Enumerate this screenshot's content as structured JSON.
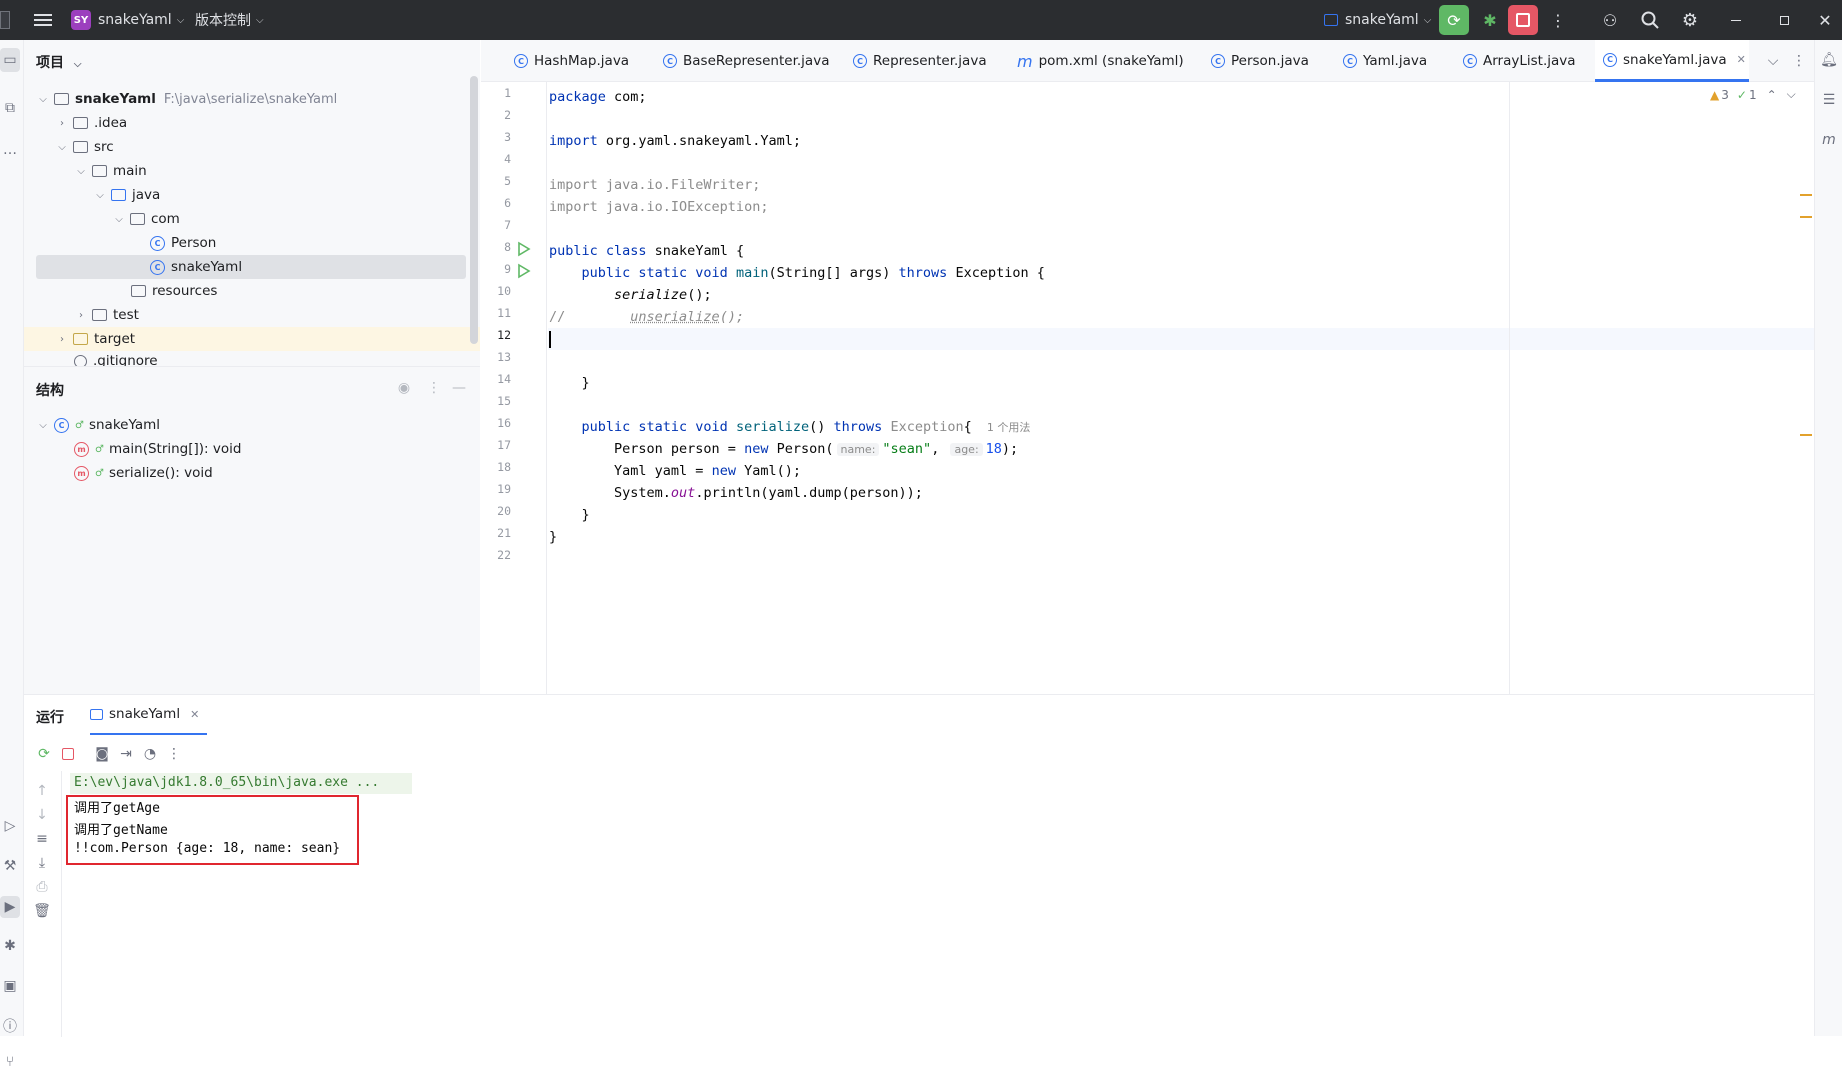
{
  "titlebar": {
    "project_badge": "SY",
    "project_name": "snakeYaml",
    "vcs_menu": "版本控制",
    "run_config": "snakeYaml",
    "colors": {
      "bg": "#2b2d30",
      "run_green": "#5fb865",
      "stop_red": "#e55765"
    }
  },
  "project_panel": {
    "title": "项目",
    "root_name": "snakeYaml",
    "root_path": "F:\\java\\serialize\\snakeYaml",
    "items": [
      {
        "label": ".idea"
      },
      {
        "label": "src"
      },
      {
        "label": "main"
      },
      {
        "label": "java"
      },
      {
        "label": "com"
      },
      {
        "label": "Person"
      },
      {
        "label": "snakeYaml"
      },
      {
        "label": "resources"
      },
      {
        "label": "test"
      },
      {
        "label": "target"
      },
      {
        "label": ".gitignore"
      }
    ]
  },
  "structure_panel": {
    "title": "结构",
    "class_name": "snakeYaml",
    "members": [
      {
        "label": "main(String[]): void"
      },
      {
        "label": "serialize(): void"
      }
    ]
  },
  "tabs": [
    {
      "label": "HashMap.java",
      "icon": "class-icon"
    },
    {
      "label": "BaseRepresenter.java",
      "icon": "class-icon"
    },
    {
      "label": "Representer.java",
      "icon": "class-icon"
    },
    {
      "label": "pom.xml (snakeYaml)",
      "icon": "maven-icon"
    },
    {
      "label": "Person.java",
      "icon": "class-icon"
    },
    {
      "label": "Yaml.java",
      "icon": "class-icon"
    },
    {
      "label": "ArrayList.java",
      "icon": "class-icon"
    },
    {
      "label": "snakeYaml.java",
      "icon": "class-icon",
      "active": true
    }
  ],
  "editor": {
    "warnings": "3",
    "checks": "1",
    "line_numbers": [
      "1",
      "2",
      "3",
      "4",
      "5",
      "6",
      "7",
      "8",
      "9",
      "10",
      "11",
      "12",
      "13",
      "14",
      "15",
      "16",
      "17",
      "18",
      "19",
      "20",
      "21",
      "22"
    ],
    "current_line": "12",
    "usage_hint": "1 个用法",
    "hint_name": "name:",
    "hint_age": "age:"
  },
  "run_panel": {
    "title": "运行",
    "tab_label": "snakeYaml",
    "command": "E:\\ev\\java\\jdk1.8.0_65\\bin\\java.exe ...",
    "output_lines": [
      "调用了getAge",
      "调用了getName",
      "!!com.Person {age: 18, name: sean}"
    ],
    "highlight_color": "#e0262f"
  }
}
